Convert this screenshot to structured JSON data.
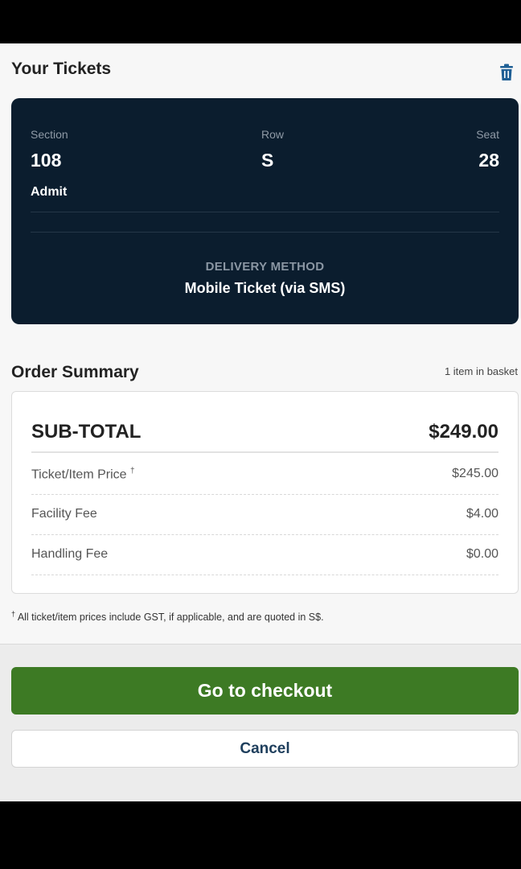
{
  "tickets": {
    "title": "Your Tickets",
    "delete_icon": "trash-icon",
    "section_label": "Section",
    "section_value": "108",
    "row_label": "Row",
    "row_value": "S",
    "seat_label": "Seat",
    "seat_value": "28",
    "admit_label": "Admit",
    "delivery_label": "DELIVERY METHOD",
    "delivery_value": "Mobile Ticket (via SMS)"
  },
  "order_summary": {
    "title": "Order Summary",
    "item_count": "1 item in basket",
    "subtotal_label": "SUB-TOTAL",
    "subtotal_value": "$249.00",
    "lines": [
      {
        "label": "Ticket/Item Price",
        "mark": "†",
        "value": "$245.00"
      },
      {
        "label": "Facility Fee",
        "mark": "",
        "value": "$4.00"
      },
      {
        "label": "Handling Fee",
        "mark": "",
        "value": "$0.00"
      }
    ],
    "footnote_mark": "†",
    "footnote": "All ticket/item prices include GST, if applicable, and are quoted in S$."
  },
  "actions": {
    "checkout_label": "Go to checkout",
    "cancel_label": "Cancel"
  },
  "colors": {
    "ticket_card_bg": "#0b1d2e",
    "checkout_green": "#3d7a24",
    "trash_blue": "#1f5f95",
    "cancel_text": "#1e3e5c"
  }
}
